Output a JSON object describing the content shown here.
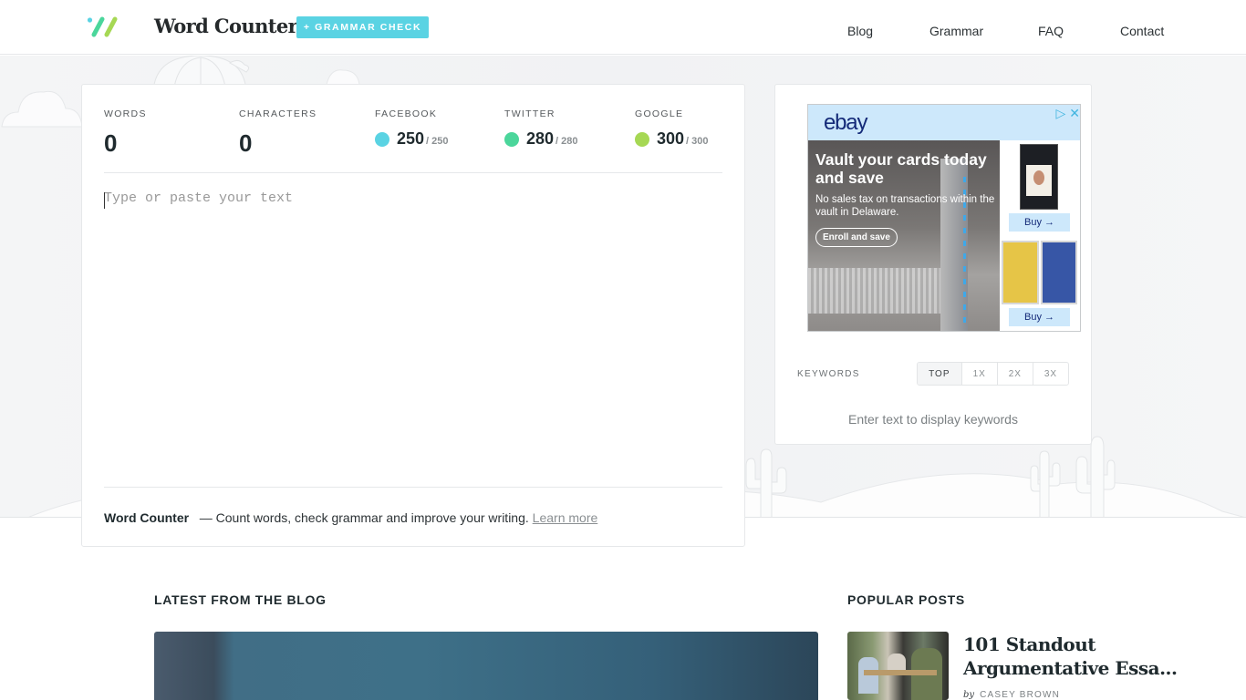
{
  "header": {
    "brand": "Word Counter",
    "grammar_button": "+ GRAMMAR CHECK",
    "nav": [
      "Blog",
      "Grammar",
      "FAQ",
      "Contact"
    ]
  },
  "stats": {
    "words": {
      "label": "WORDS",
      "value": "0"
    },
    "characters": {
      "label": "CHARACTERS",
      "value": "0"
    },
    "facebook": {
      "label": "FACEBOOK",
      "value": "250",
      "max": "/ 250",
      "color": "#5ad3e3"
    },
    "twitter": {
      "label": "TWITTER",
      "value": "280",
      "max": "/ 280",
      "color": "#4bd69b"
    },
    "google": {
      "label": "GOOGLE",
      "value": "300",
      "max": "/ 300",
      "color": "#a6d854"
    }
  },
  "editor": {
    "placeholder": "Type or paste your text",
    "value": ""
  },
  "card_footer": {
    "brand": "Word Counter",
    "tagline": "— Count words, check grammar and improve your writing.",
    "link": "Learn more"
  },
  "ad": {
    "brand": "ebay",
    "headline": "Vault your cards today and save",
    "subtext": "No sales tax on transactions within the vault in Delaware.",
    "cta": "Enroll and save",
    "buy_buttons": [
      "Buy →",
      "Buy →"
    ],
    "adchoices_icon": "▷",
    "close_icon": "✕"
  },
  "keywords": {
    "label": "KEYWORDS",
    "tabs": [
      "TOP",
      "1X",
      "2X",
      "3X"
    ],
    "active_tab": "TOP",
    "empty_message": "Enter text to display keywords"
  },
  "blog": {
    "latest_title": "LATEST FROM THE BLOG",
    "popular_title": "POPULAR POSTS",
    "popular_posts": [
      {
        "title": "101 Standout Argumentative Essa...",
        "by": "by",
        "author": "CASEY BROWN"
      }
    ]
  },
  "colors": {
    "accent": "#5ad3e3",
    "facebook": "#5ad3e3",
    "twitter": "#4bd69b",
    "google": "#a6d854"
  }
}
